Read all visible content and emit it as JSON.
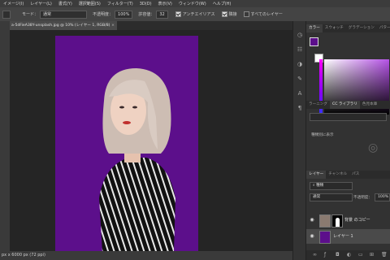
{
  "menu": [
    "イメージ(I)",
    "レイヤー(L)",
    "書式(Y)",
    "選択範囲(S)",
    "フィルター(T)",
    "3D(D)",
    "表示(V)",
    "ウィンドウ(W)",
    "ヘルプ(H)"
  ],
  "options": {
    "mode_label": "モード：",
    "mode_value": "通常",
    "opacity_label": "不透明度：",
    "opacity_value": "100%",
    "tolerance_label": "許容値：",
    "tolerance_value": "32",
    "antialias_label": "アンチエイリアス",
    "contiguous_label": "隣接",
    "all_layers_label": "すべてのレイヤー"
  },
  "document": {
    "tab_title": "a-5dFieA38Y-unsplash.jpg @ 10% (レイヤー 1, RGB/8)",
    "close_glyph": "×",
    "status": "px x 6000 px (72 ppi)",
    "canvas_color": "#5c0f8b"
  },
  "panels": {
    "color_tabs": [
      "カラー",
      "スウォッチ",
      "グラデーション",
      "パターン"
    ],
    "fg_color": "#5c0f8b",
    "bg_color": "#ffffff",
    "library_tabs": [
      "ラーニング",
      "CC ライブラリ",
      "色見本庫"
    ],
    "library_hint": "種類別に表示",
    "layers_tabs": [
      "レイヤー",
      "チャンネル",
      "パス"
    ],
    "kind_filter": "種類",
    "blend_mode": "通常",
    "opacity_label": "不透明度：",
    "opacity_value": "100%"
  },
  "layers": [
    {
      "name": "背景 のコピー",
      "visible": true,
      "selected": false
    },
    {
      "name": "レイヤー 1",
      "visible": true,
      "selected": true
    }
  ]
}
